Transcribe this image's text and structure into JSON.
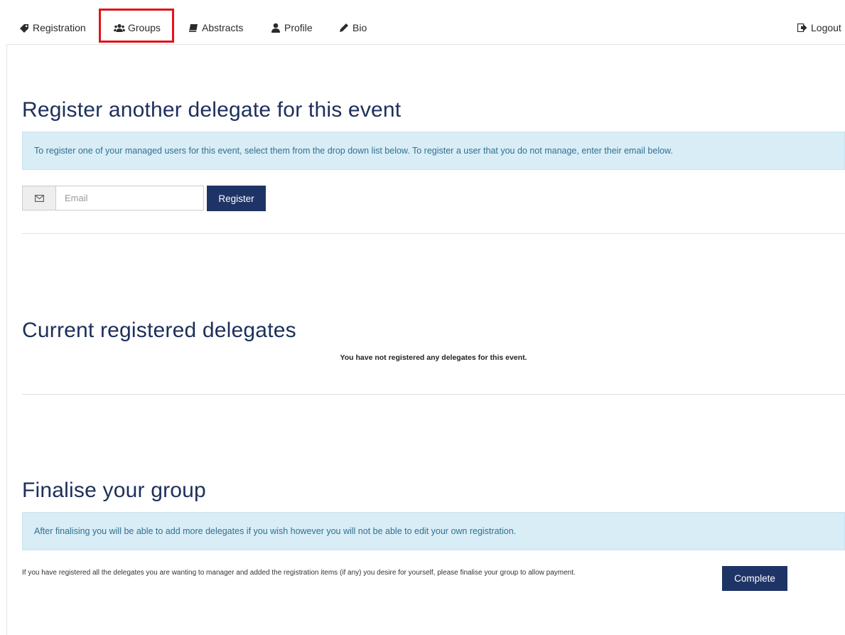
{
  "nav": {
    "items": [
      {
        "label": "Registration",
        "icon": "tag-icon"
      },
      {
        "label": "Groups",
        "icon": "users-icon"
      },
      {
        "label": "Abstracts",
        "icon": "book-icon"
      },
      {
        "label": "Profile",
        "icon": "user-icon"
      },
      {
        "label": "Bio",
        "icon": "pencil-icon"
      }
    ],
    "logout": {
      "label": "Logout",
      "icon": "logout-icon"
    },
    "active": "Groups",
    "highlight_color": "#e0141a"
  },
  "register_section": {
    "title": "Register another delegate for this event",
    "info": "To register one of your managed users for this event, select them from the drop down list below. To register a user that you do not manage, enter their email below.",
    "email_placeholder": "Email",
    "email_value": "",
    "email_icon": "envelope-icon",
    "register_label": "Register"
  },
  "current_section": {
    "title": "Current registered delegates",
    "empty_message": "You have not registered any delegates for this event."
  },
  "finalise_section": {
    "title": "Finalise your group",
    "info": "After finalising you will be able to add more delegates if you wish however you will not be able to edit your own registration.",
    "description": "If you have registered all the delegates you are wanting to manager and added the registration items (if any) you desire for yourself, please finalise your group to allow payment.",
    "complete_label": "Complete"
  },
  "colors": {
    "heading": "#1d2f5b",
    "button": "#1f3466",
    "alert_bg": "#d9edf7",
    "alert_text": "#31708f"
  }
}
